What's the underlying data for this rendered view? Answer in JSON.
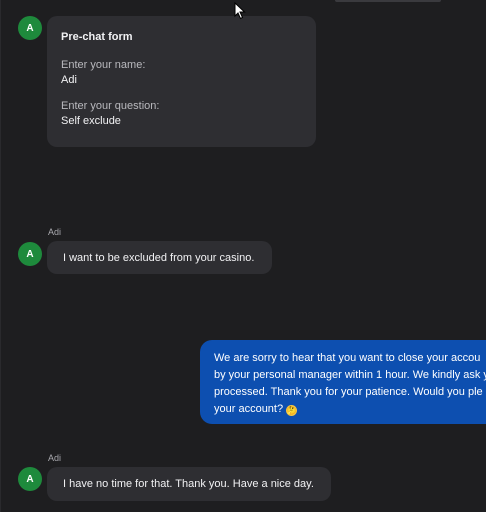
{
  "prechat_form": {
    "avatar_initial": "A",
    "title": "Pre-chat form",
    "name_label": "Enter your name:",
    "name_value": "Adi",
    "question_label": "Enter your question:",
    "question_value": "Self exclude"
  },
  "messages": [
    {
      "sender": "Adi",
      "avatar_initial": "A",
      "text": "I want to be excluded from your casino."
    },
    {
      "lines": [
        "We are sorry to hear that you want to close your accou",
        "by your personal manager within 1 hour. We kindly ask y",
        "processed. Thank you for your patience. Would you ple",
        "your account?"
      ],
      "emoji": "🤔"
    },
    {
      "sender": "Adi",
      "avatar_initial": "A",
      "text": "I have no time for that. Thank you. Have a nice day."
    }
  ],
  "colors": {
    "background": "#1e1e20",
    "incoming_bubble": "#2e2e32",
    "outgoing_bubble": "#0d4fb0",
    "avatar": "#1e8a3c"
  },
  "icons": {
    "cursor": "mouse-pointer-icon",
    "avatar": "agent-avatar-icon"
  }
}
